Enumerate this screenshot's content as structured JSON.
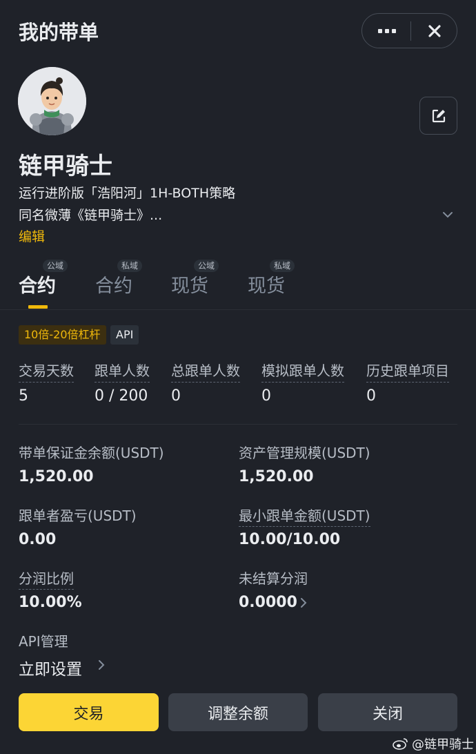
{
  "header": {
    "title": "我的带单"
  },
  "profile": {
    "name": "链甲骑士",
    "bio_line1": "运行进阶版「浩阳河」1H-BOTH策略",
    "bio_line2": "同名微薄《链甲骑士》...",
    "edit_label": "编辑"
  },
  "tabs": [
    {
      "label": "合约",
      "badge": "公域",
      "active": true
    },
    {
      "label": "合约",
      "badge": "私域",
      "active": false
    },
    {
      "label": "现货",
      "badge": "公域",
      "active": false
    },
    {
      "label": "现货",
      "badge": "私域",
      "active": false
    }
  ],
  "tags": {
    "leverage": "10倍-20倍杠杆",
    "api": "API"
  },
  "stats": [
    {
      "label": "交易天数",
      "value": "5"
    },
    {
      "label": "跟单人数",
      "value": "0 / 200"
    },
    {
      "label": "总跟单人数",
      "value": "0"
    },
    {
      "label": "模拟跟单人数",
      "value": "0"
    },
    {
      "label": "历史跟单项目",
      "value": "0"
    }
  ],
  "fields": {
    "margin_balance": {
      "label": "带单保证金余额(USDT)",
      "value": "1,520.00"
    },
    "aum": {
      "label": "资产管理规模(USDT)",
      "value": "1,520.00"
    },
    "follower_pnl": {
      "label": "跟单者盈亏(USDT)",
      "value": "0.00"
    },
    "min_copy": {
      "label": "最小跟单金额(USDT)",
      "value": "10.00/10.00"
    },
    "profit_share": {
      "label": "分润比例",
      "value": "10.00%"
    },
    "unsettled": {
      "label": "未结算分润",
      "value": "0.0000"
    },
    "api_manage": {
      "label": "API管理",
      "value": "立即设置"
    }
  },
  "buttons": {
    "trade": "交易",
    "adjust": "调整余额",
    "close": "关闭"
  },
  "watermark": "@链甲骑士",
  "colors": {
    "background": "#1f2229",
    "accent": "#f0b90b",
    "primary_button": "#fcd535"
  }
}
